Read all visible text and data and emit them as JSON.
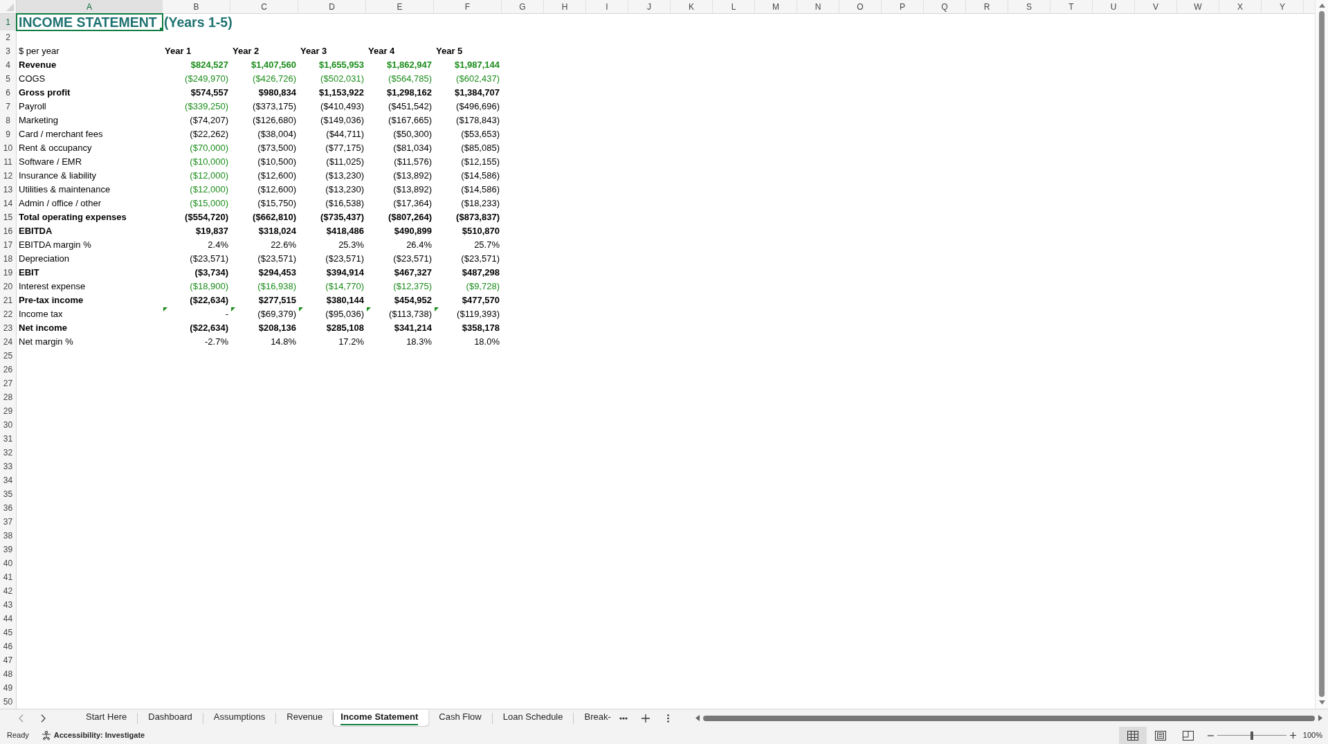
{
  "sheet": {
    "columns": [
      {
        "label": "A",
        "selected": true
      },
      {
        "label": "B",
        "selected": false
      },
      {
        "label": "C",
        "selected": false
      },
      {
        "label": "D",
        "selected": false
      },
      {
        "label": "E",
        "selected": false
      },
      {
        "label": "F",
        "selected": false
      },
      {
        "label": "G",
        "selected": false
      },
      {
        "label": "H",
        "selected": false
      },
      {
        "label": "I",
        "selected": false
      },
      {
        "label": "J",
        "selected": false
      },
      {
        "label": "K",
        "selected": false
      },
      {
        "label": "L",
        "selected": false
      },
      {
        "label": "M",
        "selected": false
      },
      {
        "label": "N",
        "selected": false
      },
      {
        "label": "O",
        "selected": false
      },
      {
        "label": "P",
        "selected": false
      },
      {
        "label": "Q",
        "selected": false
      },
      {
        "label": "R",
        "selected": false
      },
      {
        "label": "S",
        "selected": false
      },
      {
        "label": "T",
        "selected": false
      },
      {
        "label": "U",
        "selected": false
      },
      {
        "label": "V",
        "selected": false
      },
      {
        "label": "W",
        "selected": false
      },
      {
        "label": "X",
        "selected": false
      },
      {
        "label": "Y",
        "selected": false
      }
    ],
    "rows": [
      {
        "number": "1",
        "selected": true,
        "kind": "title",
        "label": "INCOME STATEMENT",
        "cells": [
          "(Years 1-5)"
        ]
      },
      {
        "number": "2",
        "selected": false,
        "kind": "blank"
      },
      {
        "number": "3",
        "selected": false,
        "kind": "header",
        "label": "$ per year",
        "cells": [
          "Year 1",
          "Year 2",
          "Year 3",
          "Year 4",
          "Year 5"
        ]
      },
      {
        "number": "4",
        "selected": false,
        "kind": "line",
        "bold": true,
        "label": "Revenue",
        "cells": [
          {
            "text": "$824,527",
            "input": true,
            "flagged": false
          },
          {
            "text": "$1,407,560",
            "input": true,
            "flagged": false
          },
          {
            "text": "$1,655,953",
            "input": true,
            "flagged": false
          },
          {
            "text": "$1,862,947",
            "input": true,
            "flagged": false
          },
          {
            "text": "$1,987,144",
            "input": true,
            "flagged": false
          }
        ]
      },
      {
        "number": "5",
        "selected": false,
        "kind": "line",
        "bold": false,
        "label": "COGS",
        "cells": [
          {
            "text": "($249,970)",
            "input": true,
            "flagged": false
          },
          {
            "text": "($426,726)",
            "input": true,
            "flagged": false
          },
          {
            "text": "($502,031)",
            "input": true,
            "flagged": false
          },
          {
            "text": "($564,785)",
            "input": true,
            "flagged": false
          },
          {
            "text": "($602,437)",
            "input": true,
            "flagged": false
          }
        ]
      },
      {
        "number": "6",
        "selected": false,
        "kind": "line",
        "bold": true,
        "label": "Gross profit",
        "cells": [
          {
            "text": "$574,557",
            "input": false,
            "flagged": false
          },
          {
            "text": "$980,834",
            "input": false,
            "flagged": false
          },
          {
            "text": "$1,153,922",
            "input": false,
            "flagged": false
          },
          {
            "text": "$1,298,162",
            "input": false,
            "flagged": false
          },
          {
            "text": "$1,384,707",
            "input": false,
            "flagged": false
          }
        ]
      },
      {
        "number": "7",
        "selected": false,
        "kind": "line",
        "bold": false,
        "label": "Payroll",
        "cells": [
          {
            "text": "($339,250)",
            "input": true,
            "flagged": false
          },
          {
            "text": "($373,175)",
            "input": false,
            "flagged": false
          },
          {
            "text": "($410,493)",
            "input": false,
            "flagged": false
          },
          {
            "text": "($451,542)",
            "input": false,
            "flagged": false
          },
          {
            "text": "($496,696)",
            "input": false,
            "flagged": false
          }
        ]
      },
      {
        "number": "8",
        "selected": false,
        "kind": "line",
        "bold": false,
        "label": "Marketing",
        "cells": [
          {
            "text": "($74,207)",
            "input": false,
            "flagged": false
          },
          {
            "text": "($126,680)",
            "input": false,
            "flagged": false
          },
          {
            "text": "($149,036)",
            "input": false,
            "flagged": false
          },
          {
            "text": "($167,665)",
            "input": false,
            "flagged": false
          },
          {
            "text": "($178,843)",
            "input": false,
            "flagged": false
          }
        ]
      },
      {
        "number": "9",
        "selected": false,
        "kind": "line",
        "bold": false,
        "label": "Card / merchant fees",
        "cells": [
          {
            "text": "($22,262)",
            "input": false,
            "flagged": false
          },
          {
            "text": "($38,004)",
            "input": false,
            "flagged": false
          },
          {
            "text": "($44,711)",
            "input": false,
            "flagged": false
          },
          {
            "text": "($50,300)",
            "input": false,
            "flagged": false
          },
          {
            "text": "($53,653)",
            "input": false,
            "flagged": false
          }
        ]
      },
      {
        "number": "10",
        "selected": false,
        "kind": "line",
        "bold": false,
        "label": "Rent & occupancy",
        "cells": [
          {
            "text": "($70,000)",
            "input": true,
            "flagged": false
          },
          {
            "text": "($73,500)",
            "input": false,
            "flagged": false
          },
          {
            "text": "($77,175)",
            "input": false,
            "flagged": false
          },
          {
            "text": "($81,034)",
            "input": false,
            "flagged": false
          },
          {
            "text": "($85,085)",
            "input": false,
            "flagged": false
          }
        ]
      },
      {
        "number": "11",
        "selected": false,
        "kind": "line",
        "bold": false,
        "label": "Software / EMR",
        "cells": [
          {
            "text": "($10,000)",
            "input": true,
            "flagged": false
          },
          {
            "text": "($10,500)",
            "input": false,
            "flagged": false
          },
          {
            "text": "($11,025)",
            "input": false,
            "flagged": false
          },
          {
            "text": "($11,576)",
            "input": false,
            "flagged": false
          },
          {
            "text": "($12,155)",
            "input": false,
            "flagged": false
          }
        ]
      },
      {
        "number": "12",
        "selected": false,
        "kind": "line",
        "bold": false,
        "label": "Insurance & liability",
        "cells": [
          {
            "text": "($12,000)",
            "input": true,
            "flagged": false
          },
          {
            "text": "($12,600)",
            "input": false,
            "flagged": false
          },
          {
            "text": "($13,230)",
            "input": false,
            "flagged": false
          },
          {
            "text": "($13,892)",
            "input": false,
            "flagged": false
          },
          {
            "text": "($14,586)",
            "input": false,
            "flagged": false
          }
        ]
      },
      {
        "number": "13",
        "selected": false,
        "kind": "line",
        "bold": false,
        "label": "Utilities & maintenance",
        "cells": [
          {
            "text": "($12,000)",
            "input": true,
            "flagged": false
          },
          {
            "text": "($12,600)",
            "input": false,
            "flagged": false
          },
          {
            "text": "($13,230)",
            "input": false,
            "flagged": false
          },
          {
            "text": "($13,892)",
            "input": false,
            "flagged": false
          },
          {
            "text": "($14,586)",
            "input": false,
            "flagged": false
          }
        ]
      },
      {
        "number": "14",
        "selected": false,
        "kind": "line",
        "bold": false,
        "label": "Admin / office / other",
        "cells": [
          {
            "text": "($15,000)",
            "input": true,
            "flagged": false
          },
          {
            "text": "($15,750)",
            "input": false,
            "flagged": false
          },
          {
            "text": "($16,538)",
            "input": false,
            "flagged": false
          },
          {
            "text": "($17,364)",
            "input": false,
            "flagged": false
          },
          {
            "text": "($18,233)",
            "input": false,
            "flagged": false
          }
        ]
      },
      {
        "number": "15",
        "selected": false,
        "kind": "line",
        "bold": true,
        "label": "Total operating expenses",
        "cells": [
          {
            "text": "($554,720)",
            "input": false,
            "flagged": false
          },
          {
            "text": "($662,810)",
            "input": false,
            "flagged": false
          },
          {
            "text": "($735,437)",
            "input": false,
            "flagged": false
          },
          {
            "text": "($807,264)",
            "input": false,
            "flagged": false
          },
          {
            "text": "($873,837)",
            "input": false,
            "flagged": false
          }
        ]
      },
      {
        "number": "16",
        "selected": false,
        "kind": "line",
        "bold": true,
        "label": "EBITDA",
        "cells": [
          {
            "text": "$19,837",
            "input": false,
            "flagged": false
          },
          {
            "text": "$318,024",
            "input": false,
            "flagged": false
          },
          {
            "text": "$418,486",
            "input": false,
            "flagged": false
          },
          {
            "text": "$490,899",
            "input": false,
            "flagged": false
          },
          {
            "text": "$510,870",
            "input": false,
            "flagged": false
          }
        ]
      },
      {
        "number": "17",
        "selected": false,
        "kind": "line",
        "bold": false,
        "label": "EBITDA margin %",
        "cells": [
          {
            "text": "2.4%",
            "input": false,
            "flagged": false
          },
          {
            "text": "22.6%",
            "input": false,
            "flagged": false
          },
          {
            "text": "25.3%",
            "input": false,
            "flagged": false
          },
          {
            "text": "26.4%",
            "input": false,
            "flagged": false
          },
          {
            "text": "25.7%",
            "input": false,
            "flagged": false
          }
        ]
      },
      {
        "number": "18",
        "selected": false,
        "kind": "line",
        "bold": false,
        "label": "Depreciation",
        "cells": [
          {
            "text": "($23,571)",
            "input": false,
            "flagged": false
          },
          {
            "text": "($23,571)",
            "input": false,
            "flagged": false
          },
          {
            "text": "($23,571)",
            "input": false,
            "flagged": false
          },
          {
            "text": "($23,571)",
            "input": false,
            "flagged": false
          },
          {
            "text": "($23,571)",
            "input": false,
            "flagged": false
          }
        ]
      },
      {
        "number": "19",
        "selected": false,
        "kind": "line",
        "bold": true,
        "label": "EBIT",
        "cells": [
          {
            "text": "($3,734)",
            "input": false,
            "flagged": false
          },
          {
            "text": "$294,453",
            "input": false,
            "flagged": false
          },
          {
            "text": "$394,914",
            "input": false,
            "flagged": false
          },
          {
            "text": "$467,327",
            "input": false,
            "flagged": false
          },
          {
            "text": "$487,298",
            "input": false,
            "flagged": false
          }
        ]
      },
      {
        "number": "20",
        "selected": false,
        "kind": "line",
        "bold": false,
        "label": "Interest expense",
        "cells": [
          {
            "text": "($18,900)",
            "input": true,
            "flagged": false
          },
          {
            "text": "($16,938)",
            "input": true,
            "flagged": false
          },
          {
            "text": "($14,770)",
            "input": true,
            "flagged": false
          },
          {
            "text": "($12,375)",
            "input": true,
            "flagged": false
          },
          {
            "text": "($9,728)",
            "input": true,
            "flagged": false
          }
        ]
      },
      {
        "number": "21",
        "selected": false,
        "kind": "line",
        "bold": true,
        "label": "Pre-tax income",
        "cells": [
          {
            "text": "($22,634)",
            "input": false,
            "flagged": false
          },
          {
            "text": "$277,515",
            "input": false,
            "flagged": false
          },
          {
            "text": "$380,144",
            "input": false,
            "flagged": false
          },
          {
            "text": "$454,952",
            "input": false,
            "flagged": false
          },
          {
            "text": "$477,570",
            "input": false,
            "flagged": false
          }
        ]
      },
      {
        "number": "22",
        "selected": false,
        "kind": "line",
        "bold": false,
        "label": "Income tax",
        "cells": [
          {
            "text": "-",
            "input": false,
            "flagged": true
          },
          {
            "text": "($69,379)",
            "input": false,
            "flagged": true
          },
          {
            "text": "($95,036)",
            "input": false,
            "flagged": true
          },
          {
            "text": "($113,738)",
            "input": false,
            "flagged": true
          },
          {
            "text": "($119,393)",
            "input": false,
            "flagged": true
          }
        ]
      },
      {
        "number": "23",
        "selected": false,
        "kind": "line",
        "bold": true,
        "label": "Net income",
        "cells": [
          {
            "text": "($22,634)",
            "input": false,
            "flagged": false
          },
          {
            "text": "$208,136",
            "input": false,
            "flagged": false
          },
          {
            "text": "$285,108",
            "input": false,
            "flagged": false
          },
          {
            "text": "$341,214",
            "input": false,
            "flagged": false
          },
          {
            "text": "$358,178",
            "input": false,
            "flagged": false
          }
        ]
      },
      {
        "number": "24",
        "selected": false,
        "kind": "line",
        "bold": false,
        "label": "Net margin %",
        "cells": [
          {
            "text": "-2.7%",
            "input": false,
            "flagged": false
          },
          {
            "text": "14.8%",
            "input": false,
            "flagged": false
          },
          {
            "text": "17.2%",
            "input": false,
            "flagged": false
          },
          {
            "text": "18.3%",
            "input": false,
            "flagged": false
          },
          {
            "text": "18.0%",
            "input": false,
            "flagged": false
          }
        ]
      },
      {
        "number": "25",
        "selected": false,
        "kind": "blank"
      },
      {
        "number": "26",
        "selected": false,
        "kind": "blank"
      },
      {
        "number": "27",
        "selected": false,
        "kind": "blank"
      },
      {
        "number": "28",
        "selected": false,
        "kind": "blank"
      },
      {
        "number": "29",
        "selected": false,
        "kind": "blank"
      },
      {
        "number": "30",
        "selected": false,
        "kind": "blank"
      },
      {
        "number": "31",
        "selected": false,
        "kind": "blank"
      },
      {
        "number": "32",
        "selected": false,
        "kind": "blank"
      },
      {
        "number": "33",
        "selected": false,
        "kind": "blank"
      },
      {
        "number": "34",
        "selected": false,
        "kind": "blank"
      },
      {
        "number": "35",
        "selected": false,
        "kind": "blank"
      },
      {
        "number": "36",
        "selected": false,
        "kind": "blank"
      },
      {
        "number": "37",
        "selected": false,
        "kind": "blank"
      },
      {
        "number": "38",
        "selected": false,
        "kind": "blank"
      },
      {
        "number": "39",
        "selected": false,
        "kind": "blank"
      },
      {
        "number": "40",
        "selected": false,
        "kind": "blank"
      },
      {
        "number": "41",
        "selected": false,
        "kind": "blank"
      },
      {
        "number": "42",
        "selected": false,
        "kind": "blank"
      },
      {
        "number": "43",
        "selected": false,
        "kind": "blank"
      },
      {
        "number": "44",
        "selected": false,
        "kind": "blank"
      },
      {
        "number": "45",
        "selected": false,
        "kind": "blank"
      },
      {
        "number": "46",
        "selected": false,
        "kind": "blank"
      },
      {
        "number": "47",
        "selected": false,
        "kind": "blank"
      },
      {
        "number": "48",
        "selected": false,
        "kind": "blank"
      },
      {
        "number": "49",
        "selected": false,
        "kind": "blank"
      },
      {
        "number": "50",
        "selected": false,
        "kind": "blank"
      }
    ]
  },
  "sheet_tabs": [
    {
      "label": "Start Here",
      "selected": false
    },
    {
      "label": "Dashboard",
      "selected": false
    },
    {
      "label": "Assumptions",
      "selected": false
    },
    {
      "label": "Revenue",
      "selected": false
    },
    {
      "label": "Income Statement",
      "selected": true
    },
    {
      "label": "Cash Flow",
      "selected": false
    },
    {
      "label": "Loan Schedule",
      "selected": false
    },
    {
      "label": "Break-",
      "selected": false
    }
  ],
  "status_bar": {
    "status": "Ready",
    "accessibility": "Accessibility: Investigate",
    "views": [
      {
        "kind": "normal",
        "selected": true
      },
      {
        "kind": "page_layout",
        "selected": false
      },
      {
        "kind": "page_break",
        "selected": false
      }
    ],
    "zoom": {
      "level": 0.5,
      "reading": "100%"
    }
  }
}
